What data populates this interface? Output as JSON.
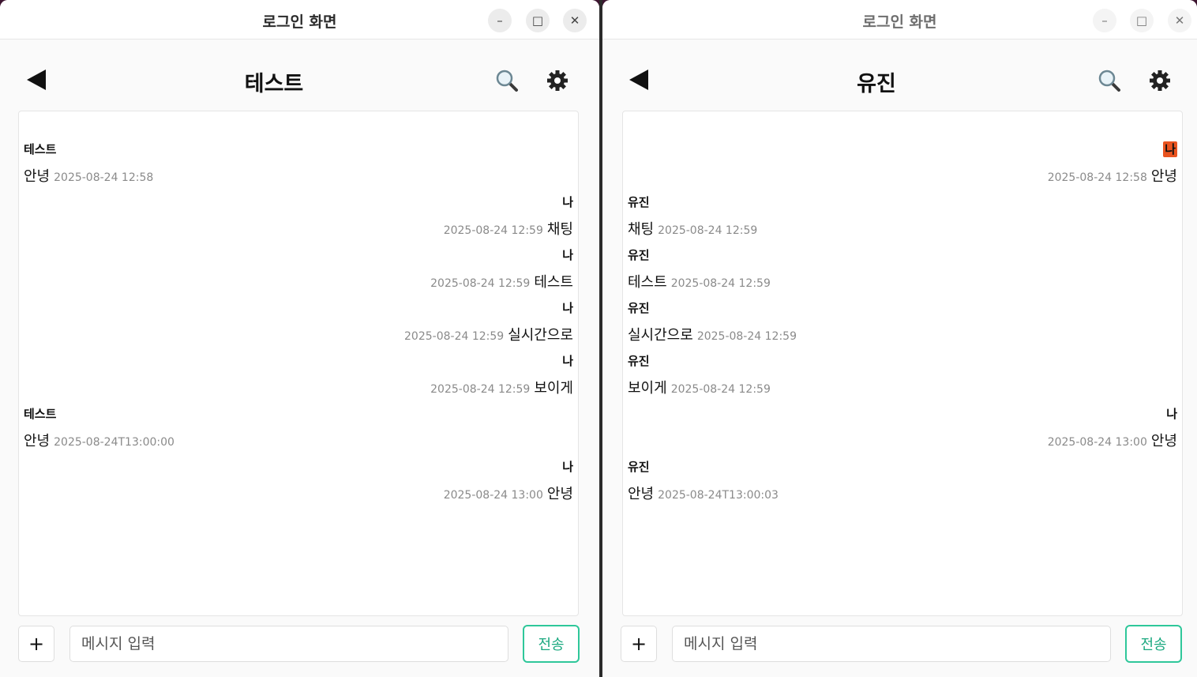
{
  "left_window": {
    "title": "로그인 화면",
    "chat_title": "테스트",
    "input_placeholder": "메시지 입력",
    "send_label": "전송",
    "plus_label": "+",
    "messages": [
      {
        "sender": "테스트",
        "text": "안녕",
        "time": "2025-08-24 12:58",
        "mine": false
      },
      {
        "sender": "나",
        "text": "채팅",
        "time": "2025-08-24 12:59",
        "mine": true
      },
      {
        "sender": "나",
        "text": "테스트",
        "time": "2025-08-24 12:59",
        "mine": true
      },
      {
        "sender": "나",
        "text": "실시간으로",
        "time": "2025-08-24 12:59",
        "mine": true
      },
      {
        "sender": "나",
        "text": "보이게",
        "time": "2025-08-24 12:59",
        "mine": true
      },
      {
        "sender": "테스트",
        "text": "안녕",
        "time": "2025-08-24T13:00:00",
        "mine": false
      },
      {
        "sender": "나",
        "text": "안녕",
        "time": "2025-08-24 13:00",
        "mine": true
      }
    ]
  },
  "right_window": {
    "title": "로그인 화면",
    "chat_title": "유진",
    "input_placeholder": "메시지 입력",
    "send_label": "전송",
    "plus_label": "+",
    "messages": [
      {
        "sender": "나",
        "text": "안녕",
        "time": "2025-08-24 12:58",
        "mine": true,
        "highlight": true
      },
      {
        "sender": "유진",
        "text": "채팅",
        "time": "2025-08-24 12:59",
        "mine": false
      },
      {
        "sender": "유진",
        "text": "테스트",
        "time": "2025-08-24 12:59",
        "mine": false
      },
      {
        "sender": "유진",
        "text": "실시간으로",
        "time": "2025-08-24 12:59",
        "mine": false
      },
      {
        "sender": "유진",
        "text": "보이게",
        "time": "2025-08-24 12:59",
        "mine": false
      },
      {
        "sender": "나",
        "text": "안녕",
        "time": "2025-08-24 13:00",
        "mine": true
      },
      {
        "sender": "유진",
        "text": "안녕",
        "time": "2025-08-24T13:00:03",
        "mine": false
      }
    ]
  },
  "colors": {
    "accent_green": "#2fc79a",
    "highlight_orange": "#e95420",
    "desktop_bg": "#3d1530"
  },
  "icons": {
    "back": "back-arrow-icon",
    "search": "search-icon",
    "settings": "gear-icon",
    "minimize": "minimize-icon",
    "maximize": "maximize-icon",
    "close": "close-icon"
  }
}
